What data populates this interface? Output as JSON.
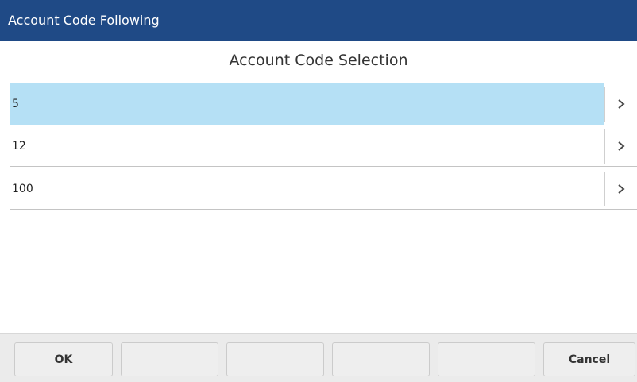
{
  "title_bar": {
    "text": "Account Code Following"
  },
  "heading": {
    "text": "Account Code Selection"
  },
  "list": {
    "items": [
      {
        "label": "5",
        "selected": true
      },
      {
        "label": "12",
        "selected": false
      },
      {
        "label": "100",
        "selected": false
      }
    ]
  },
  "softkeys": {
    "keys": [
      {
        "label": "OK"
      },
      {
        "label": ""
      },
      {
        "label": ""
      },
      {
        "label": ""
      },
      {
        "label": ""
      },
      {
        "label": "Cancel"
      }
    ]
  },
  "colors": {
    "title_bar_bg": "#1f4a86",
    "selected_row_bg": "#b5e0f5"
  },
  "icons": {
    "row_arrow": "chevron-right-icon"
  }
}
